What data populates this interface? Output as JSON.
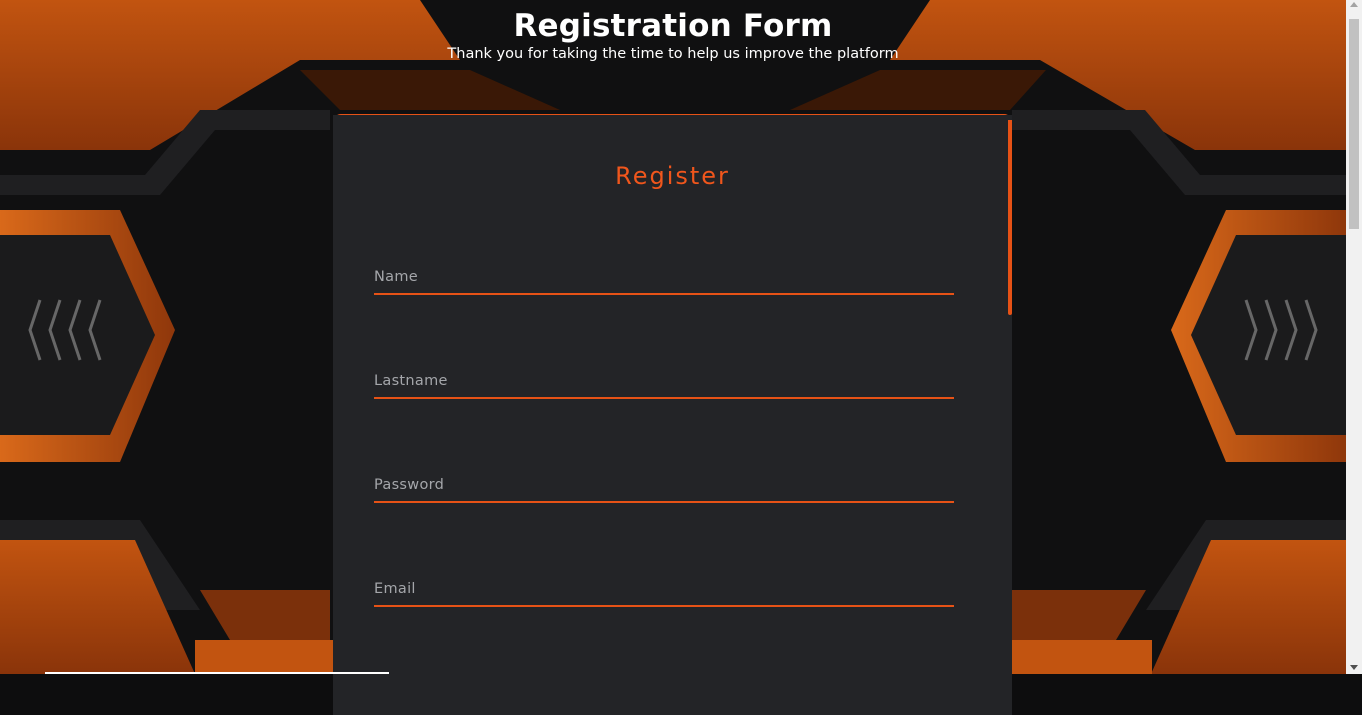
{
  "header": {
    "title": "Registration Form",
    "subtitle": "Thank you for taking the time to help us improve the platform"
  },
  "form": {
    "heading": "Register",
    "fields": [
      {
        "placeholder": "Name",
        "type": "text"
      },
      {
        "placeholder": "Lastname",
        "type": "text"
      },
      {
        "placeholder": "Password",
        "type": "password"
      },
      {
        "placeholder": "Email",
        "type": "email"
      }
    ]
  },
  "colors": {
    "accent": "#e65216",
    "card": "#232427",
    "background_orange": "#b5480f",
    "background_dark": "#0f0f10"
  }
}
